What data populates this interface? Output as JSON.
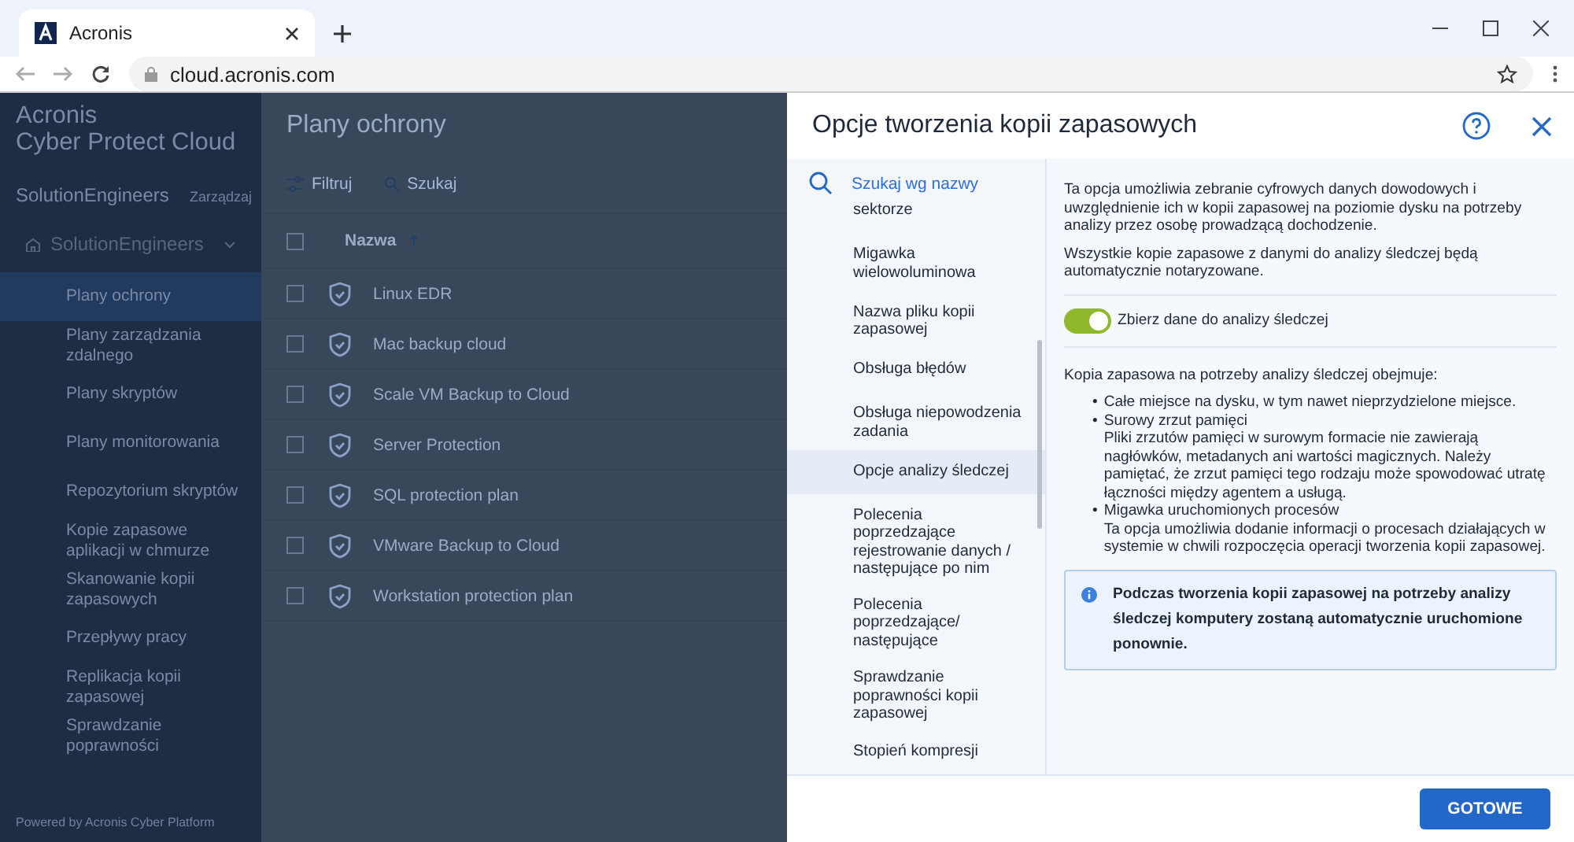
{
  "browser": {
    "tab_title": "Acronis",
    "url": "cloud.acronis.com"
  },
  "sidebar": {
    "brand": [
      "Acronis",
      "Cyber Protect Cloud"
    ],
    "tenant": "SolutionEngineers",
    "manage": "Zarządzaj",
    "unit": "SolutionEngineers",
    "items": [
      {
        "label": "Plany ochrony",
        "selected": true
      },
      {
        "label": "Plany zarządzania zdalnego",
        "selected": false
      },
      {
        "label": "Plany skryptów",
        "selected": false
      },
      {
        "label": "Plany monitorowania",
        "selected": false
      },
      {
        "label": "Repozytorium skryptów",
        "selected": false
      },
      {
        "label": "Kopie zapasowe aplikacji w chmurze",
        "selected": false
      },
      {
        "label": "Skanowanie kopii zapasowych",
        "selected": false
      },
      {
        "label": "Przepływy pracy",
        "selected": false
      },
      {
        "label": "Replikacja kopii zapasowej",
        "selected": false
      },
      {
        "label": "Sprawdzanie poprawności",
        "selected": false
      }
    ],
    "footer": "Powered by Acronis Cyber Platform"
  },
  "main": {
    "title": "Plany ochrony",
    "toolbar": [
      "Filtruj",
      "Szukaj"
    ],
    "column": "Nazwa",
    "select_all_checked": false,
    "rows": [
      {
        "name": "Linux EDR",
        "checked": false
      },
      {
        "name": "Mac backup cloud",
        "checked": false
      },
      {
        "name": "Scale VM Backup to Cloud",
        "checked": false
      },
      {
        "name": "Server Protection",
        "checked": false
      },
      {
        "name": "SQL protection plan",
        "checked": false
      },
      {
        "name": "VMware Backup to Cloud",
        "checked": false
      },
      {
        "name": "Workstation protection plan",
        "checked": false
      }
    ]
  },
  "dialog": {
    "title": "Opcje tworzenia kopii zapasowych",
    "search_placeholder": "Szukaj wg nazwy",
    "options": [
      {
        "label": "sektorze",
        "selected": false
      },
      {
        "label": "Migawka wielowoluminowa",
        "selected": false
      },
      {
        "label": "Nazwa pliku kopii zapasowej",
        "selected": false
      },
      {
        "label": "Obsługa błędów",
        "selected": false
      },
      {
        "label": "Obsługa niepowodzenia zadania",
        "selected": false
      },
      {
        "label": "Opcje analizy śledczej",
        "selected": true
      },
      {
        "label": "Polecenia poprzedzające rejestrowanie danych / następujące po nim",
        "selected": false
      },
      {
        "label": "Polecenia poprzedzające/ następujące",
        "selected": false
      },
      {
        "label": "Sprawdzanie poprawności kopii zapasowej",
        "selected": false
      },
      {
        "label": "Stopień kompresji",
        "selected": false
      }
    ],
    "intro": [
      "Ta opcja umożliwia zebranie cyfrowych danych dowodowych i uwzględnienie ich w kopii zapasowej na poziomie dysku na potrzeby analizy przez osobę prowadzącą dochodzenie.",
      "Wszystkie kopie zapasowe z danymi do analizy śledczej będą automatycznie notaryzowane."
    ],
    "toggle": {
      "label": "Zbierz dane do analizy śledczej",
      "on": true
    },
    "list_heading": "Kopia zapasowa na potrzeby analizy śledczej obejmuje:",
    "bullets": [
      {
        "marker": "•",
        "title": "Całe miejsce na dysku, w tym nawet nieprzydzielone miejsce."
      },
      {
        "marker": "•",
        "title": "Surowy zrzut pamięci",
        "detail": "Pliki zrzutów pamięci w surowym formacie nie zawierają nagłówków, metadanych ani wartości magicznych. Należy pamiętać, że zrzut pamięci tego rodzaju może spowodować utratę łączności między agentem a usługą."
      },
      {
        "marker": "•",
        "title": "Migawka uruchomionych procesów",
        "detail": "Ta opcja umożliwia dodanie informacji o procesach działających w systemie w chwili rozpoczęcia operacji tworzenia kopii zapasowej."
      }
    ],
    "note": "Podczas tworzenia kopii zapasowej na potrzeby analizy śledczej komputery zostaną automatycznie uruchomione ponownie.",
    "button": "GOTOWE"
  }
}
